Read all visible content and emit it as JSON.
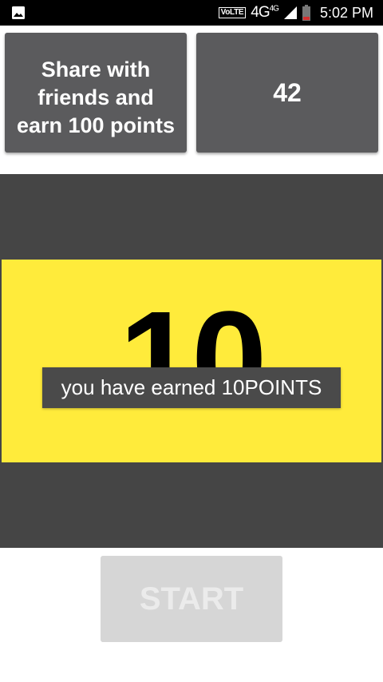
{
  "status_bar": {
    "left_icon": "image-icon",
    "volte": "VoLTE",
    "network": "4G",
    "network_sup": "4G",
    "time": "5:02 PM"
  },
  "cards": {
    "share_label": "Share with friends and earn 100 points",
    "score": "42"
  },
  "game": {
    "big_number": "10",
    "toast": "you have earned 10POINTS",
    "colors": {
      "panel": "#454545",
      "highlight": "#ffeb3b"
    }
  },
  "start_button": {
    "label": "START"
  }
}
